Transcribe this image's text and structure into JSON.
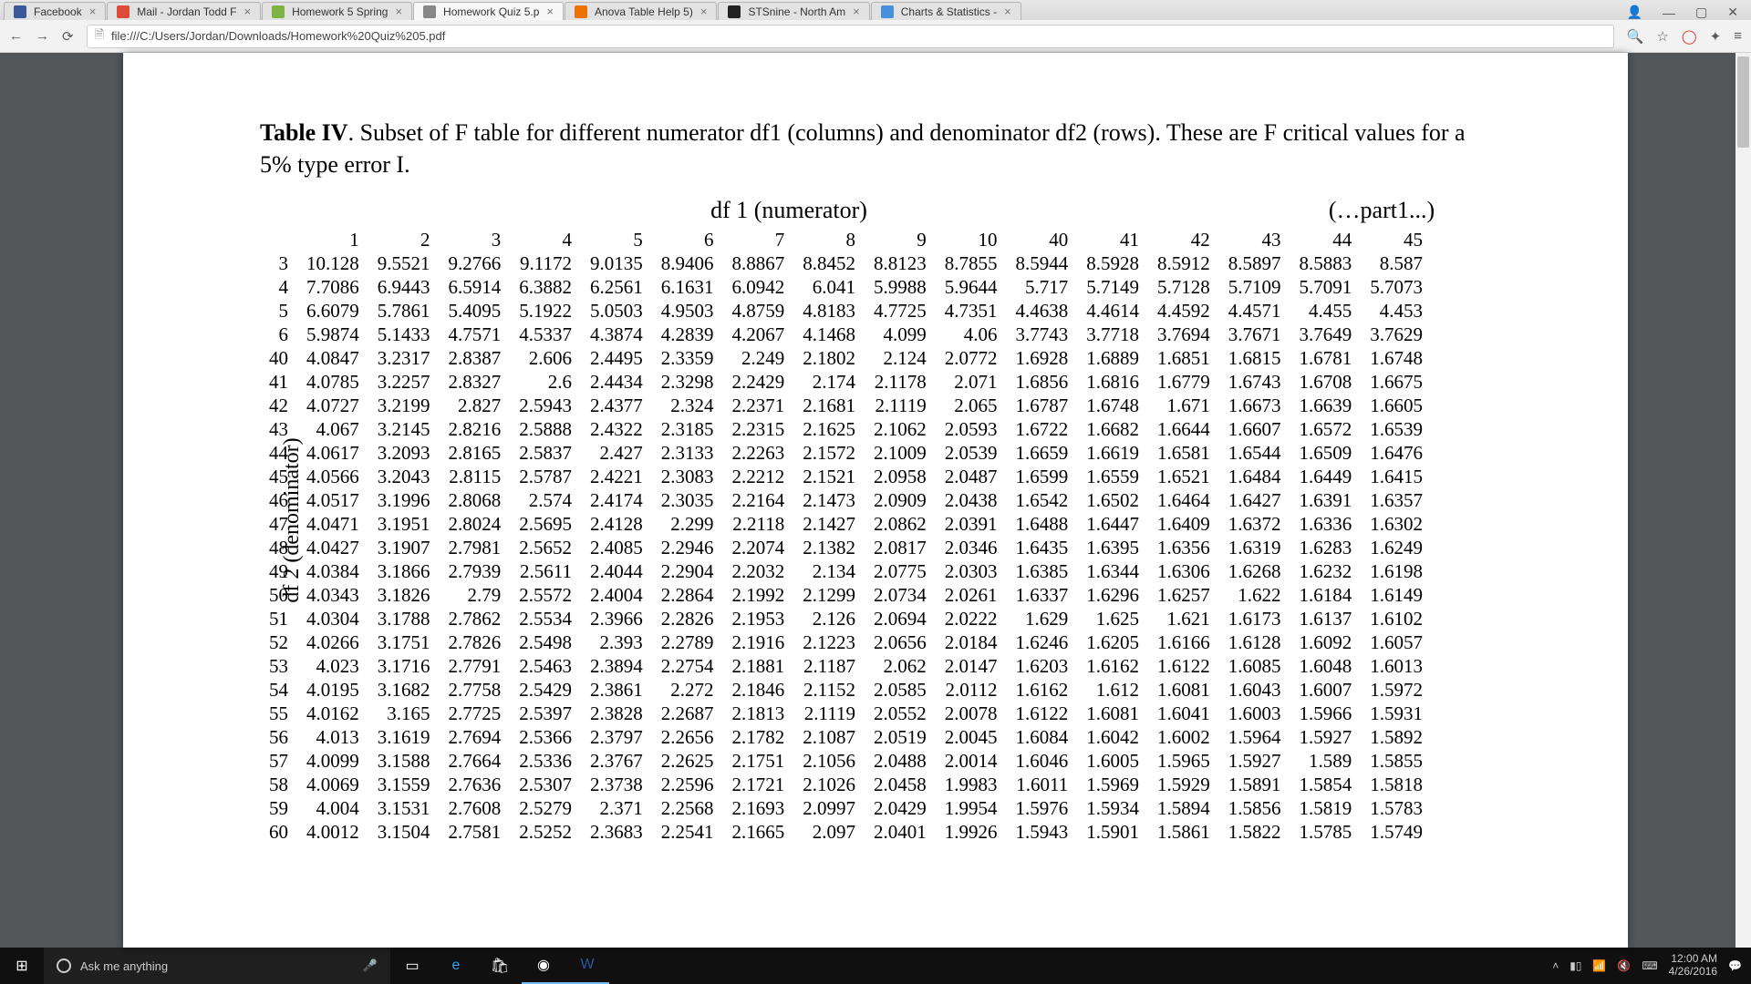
{
  "tabs": [
    {
      "label": "Facebook",
      "fav": "fav-fb"
    },
    {
      "label": "Mail - Jordan Todd F",
      "fav": "fav-mail"
    },
    {
      "label": "Homework 5 Spring",
      "fav": "fav-hw5"
    },
    {
      "label": "Homework Quiz 5.p",
      "fav": "fav-pdf",
      "active": true
    },
    {
      "label": "Anova Table Help 5)",
      "fav": "fav-chegg"
    },
    {
      "label": "STSnine - North Am",
      "fav": "fav-sts"
    },
    {
      "label": "Charts & Statistics -",
      "fav": "fav-charts"
    }
  ],
  "url": "file:///C:/Users/Jordan/Downloads/Homework%20Quiz%205.pdf",
  "caption_prefix": "Table IV",
  "caption_rest": ". Subset of F table for different numerator df1 (columns) and denominator df2 (rows). These are F critical values for a 5% type error I.",
  "top_axis_a": "df 1 (numerator)",
  "top_axis_b": "(…part1...)",
  "left_axis": "df 2 (denominator)",
  "search_placeholder": "Ask me anything",
  "clock_time": "12:00 AM",
  "clock_date": "4/26/2016",
  "chart_data": {
    "type": "table",
    "title": "Table IV. Subset of F table for different numerator df1 (columns) and denominator df2 (rows). These are F critical values for a 5% type error I.",
    "xlabel": "df 1 (numerator)",
    "ylabel": "df 2 (denominator)",
    "columns": [
      1,
      2,
      3,
      4,
      5,
      6,
      7,
      8,
      9,
      10,
      40,
      41,
      42,
      43,
      44,
      45
    ],
    "rows": [
      3,
      4,
      5,
      6,
      40,
      41,
      42,
      43,
      44,
      45,
      46,
      47,
      48,
      49,
      50,
      51,
      52,
      53,
      54,
      55,
      56,
      57,
      58,
      59,
      60
    ],
    "values": [
      [
        10.128,
        9.5521,
        9.2766,
        9.1172,
        9.0135,
        8.9406,
        8.8867,
        8.8452,
        8.8123,
        8.7855,
        8.5944,
        8.5928,
        8.5912,
        8.5897,
        8.5883,
        8.587
      ],
      [
        7.7086,
        6.9443,
        6.5914,
        6.3882,
        6.2561,
        6.1631,
        6.0942,
        6.041,
        5.9988,
        5.9644,
        5.717,
        5.7149,
        5.7128,
        5.7109,
        5.7091,
        5.7073
      ],
      [
        6.6079,
        5.7861,
        5.4095,
        5.1922,
        5.0503,
        4.9503,
        4.8759,
        4.8183,
        4.7725,
        4.7351,
        4.4638,
        4.4614,
        4.4592,
        4.4571,
        4.455,
        4.453
      ],
      [
        5.9874,
        5.1433,
        4.7571,
        4.5337,
        4.3874,
        4.2839,
        4.2067,
        4.1468,
        4.099,
        4.06,
        3.7743,
        3.7718,
        3.7694,
        3.7671,
        3.7649,
        3.7629
      ],
      [
        4.0847,
        3.2317,
        2.8387,
        2.606,
        2.4495,
        2.3359,
        2.249,
        2.1802,
        2.124,
        2.0772,
        1.6928,
        1.6889,
        1.6851,
        1.6815,
        1.6781,
        1.6748
      ],
      [
        4.0785,
        3.2257,
        2.8327,
        2.6,
        2.4434,
        2.3298,
        2.2429,
        2.174,
        2.1178,
        2.071,
        1.6856,
        1.6816,
        1.6779,
        1.6743,
        1.6708,
        1.6675
      ],
      [
        4.0727,
        3.2199,
        2.827,
        2.5943,
        2.4377,
        2.324,
        2.2371,
        2.1681,
        2.1119,
        2.065,
        1.6787,
        1.6748,
        1.671,
        1.6673,
        1.6639,
        1.6605
      ],
      [
        4.067,
        3.2145,
        2.8216,
        2.5888,
        2.4322,
        2.3185,
        2.2315,
        2.1625,
        2.1062,
        2.0593,
        1.6722,
        1.6682,
        1.6644,
        1.6607,
        1.6572,
        1.6539
      ],
      [
        4.0617,
        3.2093,
        2.8165,
        2.5837,
        2.427,
        2.3133,
        2.2263,
        2.1572,
        2.1009,
        2.0539,
        1.6659,
        1.6619,
        1.6581,
        1.6544,
        1.6509,
        1.6476
      ],
      [
        4.0566,
        3.2043,
        2.8115,
        2.5787,
        2.4221,
        2.3083,
        2.2212,
        2.1521,
        2.0958,
        2.0487,
        1.6599,
        1.6559,
        1.6521,
        1.6484,
        1.6449,
        1.6415
      ],
      [
        4.0517,
        3.1996,
        2.8068,
        2.574,
        2.4174,
        2.3035,
        2.2164,
        2.1473,
        2.0909,
        2.0438,
        1.6542,
        1.6502,
        1.6464,
        1.6427,
        1.6391,
        1.6357
      ],
      [
        4.0471,
        3.1951,
        2.8024,
        2.5695,
        2.4128,
        2.299,
        2.2118,
        2.1427,
        2.0862,
        2.0391,
        1.6488,
        1.6447,
        1.6409,
        1.6372,
        1.6336,
        1.6302
      ],
      [
        4.0427,
        3.1907,
        2.7981,
        2.5652,
        2.4085,
        2.2946,
        2.2074,
        2.1382,
        2.0817,
        2.0346,
        1.6435,
        1.6395,
        1.6356,
        1.6319,
        1.6283,
        1.6249
      ],
      [
        4.0384,
        3.1866,
        2.7939,
        2.5611,
        2.4044,
        2.2904,
        2.2032,
        2.134,
        2.0775,
        2.0303,
        1.6385,
        1.6344,
        1.6306,
        1.6268,
        1.6232,
        1.6198
      ],
      [
        4.0343,
        3.1826,
        2.79,
        2.5572,
        2.4004,
        2.2864,
        2.1992,
        2.1299,
        2.0734,
        2.0261,
        1.6337,
        1.6296,
        1.6257,
        1.622,
        1.6184,
        1.6149
      ],
      [
        4.0304,
        3.1788,
        2.7862,
        2.5534,
        2.3966,
        2.2826,
        2.1953,
        2.126,
        2.0694,
        2.0222,
        1.629,
        1.625,
        1.621,
        1.6173,
        1.6137,
        1.6102
      ],
      [
        4.0266,
        3.1751,
        2.7826,
        2.5498,
        2.393,
        2.2789,
        2.1916,
        2.1223,
        2.0656,
        2.0184,
        1.6246,
        1.6205,
        1.6166,
        1.6128,
        1.6092,
        1.6057
      ],
      [
        4.023,
        3.1716,
        2.7791,
        2.5463,
        2.3894,
        2.2754,
        2.1881,
        2.1187,
        2.062,
        2.0147,
        1.6203,
        1.6162,
        1.6122,
        1.6085,
        1.6048,
        1.6013
      ],
      [
        4.0195,
        3.1682,
        2.7758,
        2.5429,
        2.3861,
        2.272,
        2.1846,
        2.1152,
        2.0585,
        2.0112,
        1.6162,
        1.612,
        1.6081,
        1.6043,
        1.6007,
        1.5972
      ],
      [
        4.0162,
        3.165,
        2.7725,
        2.5397,
        2.3828,
        2.2687,
        2.1813,
        2.1119,
        2.0552,
        2.0078,
        1.6122,
        1.6081,
        1.6041,
        1.6003,
        1.5966,
        1.5931
      ],
      [
        4.013,
        3.1619,
        2.7694,
        2.5366,
        2.3797,
        2.2656,
        2.1782,
        2.1087,
        2.0519,
        2.0045,
        1.6084,
        1.6042,
        1.6002,
        1.5964,
        1.5927,
        1.5892
      ],
      [
        4.0099,
        3.1588,
        2.7664,
        2.5336,
        2.3767,
        2.2625,
        2.1751,
        2.1056,
        2.0488,
        2.0014,
        1.6046,
        1.6005,
        1.5965,
        1.5927,
        1.589,
        1.5855
      ],
      [
        4.0069,
        3.1559,
        2.7636,
        2.5307,
        2.3738,
        2.2596,
        2.1721,
        2.1026,
        2.0458,
        1.9983,
        1.6011,
        1.5969,
        1.5929,
        1.5891,
        1.5854,
        1.5818
      ],
      [
        4.004,
        3.1531,
        2.7608,
        2.5279,
        2.371,
        2.2568,
        2.1693,
        2.0997,
        2.0429,
        1.9954,
        1.5976,
        1.5934,
        1.5894,
        1.5856,
        1.5819,
        1.5783
      ],
      [
        4.0012,
        3.1504,
        2.7581,
        2.5252,
        2.3683,
        2.2541,
        2.1665,
        2.097,
        2.0401,
        1.9926,
        1.5943,
        1.5901,
        1.5861,
        1.5822,
        1.5785,
        1.5749
      ]
    ]
  }
}
